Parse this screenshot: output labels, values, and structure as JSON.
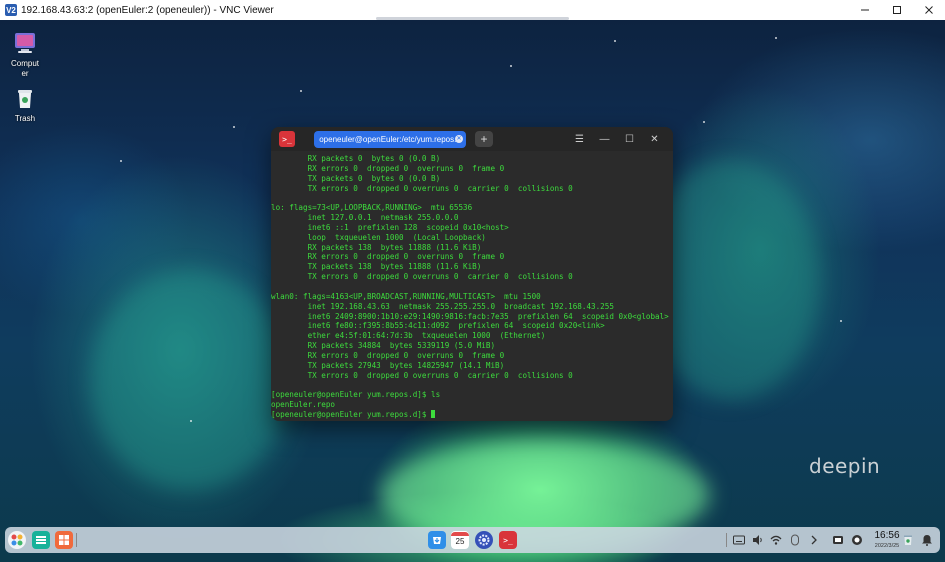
{
  "vnc": {
    "title": "192.168.43.63:2 (openEuler:2 (openeuler)) - VNC Viewer",
    "icon_text": "V2",
    "controls": [
      "minimize-icon",
      "maximize-icon",
      "close-icon"
    ]
  },
  "desktop": {
    "icons": [
      {
        "label": "Computer",
        "icon": "computer-icon"
      },
      {
        "label": "Trash",
        "icon": "trash-icon"
      }
    ],
    "watermark": "deepin"
  },
  "terminal": {
    "tab_title": "openeuler@openEuler:/etc/yum.repos.d",
    "lines": [
      "        RX packets 0  bytes 0 (0.0 B)",
      "        RX errors 0  dropped 0  overruns 0  frame 0",
      "        TX packets 0  bytes 0 (0.0 B)",
      "        TX errors 0  dropped 0 overruns 0  carrier 0  collisions 0",
      "",
      "lo: flags=73<UP,LOOPBACK,RUNNING>  mtu 65536",
      "        inet 127.0.0.1  netmask 255.0.0.0",
      "        inet6 ::1  prefixlen 128  scopeid 0x10<host>",
      "        loop  txqueuelen 1000  (Local Loopback)",
      "        RX packets 138  bytes 11888 (11.6 KiB)",
      "        RX errors 0  dropped 0  overruns 0  frame 0",
      "        TX packets 138  bytes 11888 (11.6 KiB)",
      "        TX errors 0  dropped 0 overruns 0  carrier 0  collisions 0",
      "",
      "wlan0: flags=4163<UP,BROADCAST,RUNNING,MULTICAST>  mtu 1500",
      "        inet 192.168.43.63  netmask 255.255.255.0  broadcast 192.168.43.255",
      "        inet6 2409:8900:1b10:e29:1490:9816:facb:7e35  prefixlen 64  scopeid 0x0<global>",
      "        inet6 fe80::f395:8b55:4c11:d092  prefixlen 64  scopeid 0x20<link>",
      "        ether e4:5f:01:64:7d:3b  txqueuelen 1000  (Ethernet)",
      "        RX packets 34884  bytes 5339119 (5.0 MiB)",
      "        RX errors 0  dropped 0  overruns 0  frame 0",
      "        TX packets 27943  bytes 14825947 (14.1 MiB)",
      "        TX errors 0  dropped 0 overruns 0  carrier 0  collisions 0",
      "",
      "[openeuler@openEuler yum.repos.d]$ ls",
      "openEuler.repo"
    ],
    "prompt": "[openeuler@openEuler yum.repos.d]$ "
  },
  "dock": {
    "calendar_day": "25",
    "time": "16:56",
    "date": "2022/3/25"
  },
  "colors": {
    "terminal_text": "#3ddc3d",
    "tab_active": "#2d6fe8",
    "terminal_bg": "#2b2b2b"
  }
}
